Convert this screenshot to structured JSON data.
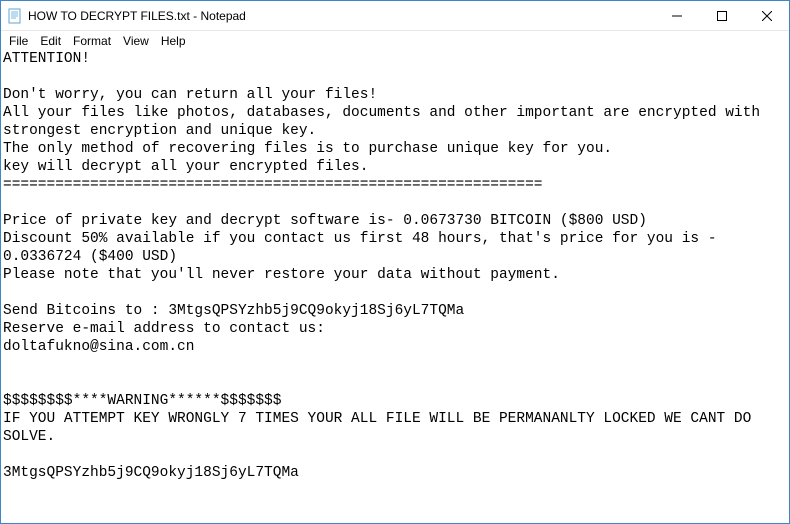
{
  "titlebar": {
    "title": "HOW TO DECRYPT FILES.txt - Notepad"
  },
  "menubar": {
    "file": "File",
    "edit": "Edit",
    "format": "Format",
    "view": "View",
    "help": "Help"
  },
  "document": {
    "body": "ATTENTION!\n\nDon't worry, you can return all your files!\nAll your files like photos, databases, documents and other important are encrypted with strongest encryption and unique key.\nThe only method of recovering files is to purchase unique key for you.\nkey will decrypt all your encrypted files.\n==============================================================\n\nPrice of private key and decrypt software is- 0.0673730 BITCOIN ($800 USD)\nDiscount 50% available if you contact us first 48 hours, that's price for you is - 0.0336724 ($400 USD)\nPlease note that you'll never restore your data without payment.\n\nSend Bitcoins to : 3MtgsQPSYzhb5j9CQ9okyj18Sj6yL7TQMa\nReserve e-mail address to contact us:\ndoltafukno@sina.com.cn\n\n\n$$$$$$$$****WARNING******$$$$$$$\nIF YOU ATTEMPT KEY WRONGLY 7 TIMES YOUR ALL FILE WILL BE PERMANANLTY LOCKED WE CANT DO SOLVE.\n\n3MtgsQPSYzhb5j9CQ9okyj18Sj6yL7TQMa"
  }
}
